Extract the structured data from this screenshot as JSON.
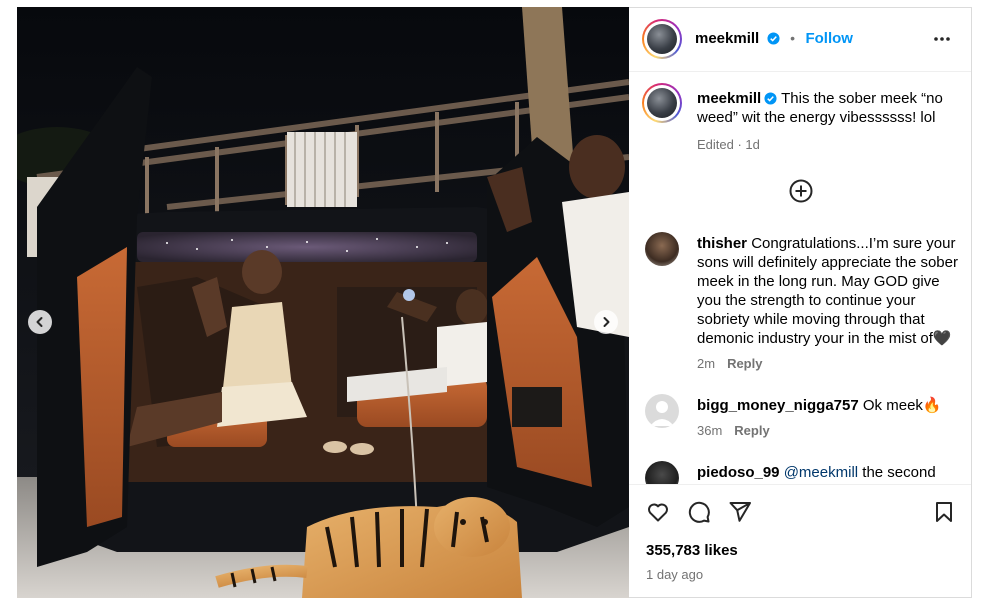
{
  "post": {
    "author": "meekmill",
    "follow_label": "Follow",
    "separator": "•",
    "caption": "This the sober meek “no weed” wit the energy vibessssss! lol",
    "caption_meta": "Edited · 1d",
    "likes": "355,783 likes",
    "posted": "1 day ago"
  },
  "comments": [
    {
      "username": "thisher",
      "text": "Congratulations...I’m sure your sons will definitely appreciate the sober meek in the long run. May GOD give you the strength to continue your sobriety while moving through that demonic industry your in the mist of🖤",
      "time": "2m",
      "reply": "Reply"
    },
    {
      "username": "bigg_money_nigga757",
      "text": "Ok meek🔥",
      "time": "36m",
      "reply": "Reply"
    },
    {
      "username": "piedoso_99",
      "mention": "@meekmill",
      "text": "the second photo should be on cover for next"
    }
  ],
  "icons": {
    "options": "more-options-icon",
    "add": "plus-circle-icon",
    "like": "heart-icon",
    "comment": "comment-bubble-icon",
    "share": "paper-plane-icon",
    "save": "bookmark-icon",
    "prev": "chevron-left-icon",
    "next": "chevron-right-icon"
  },
  "colors": {
    "accent": "#0095f6",
    "verified": "#0095f6",
    "muted": "#737373"
  }
}
